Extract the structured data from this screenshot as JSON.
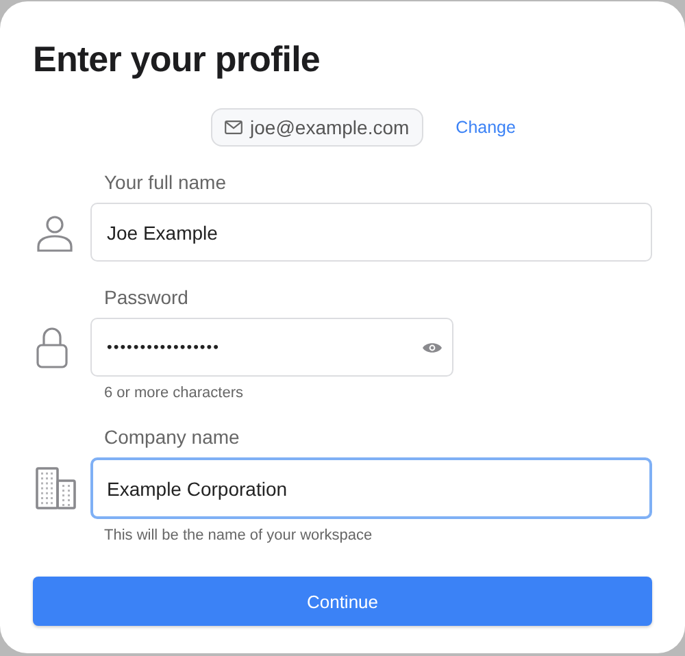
{
  "dialog": {
    "title": "Enter your profile"
  },
  "account": {
    "email": "joe@example.com",
    "change_link": "Change"
  },
  "fields": [
    {
      "kind": "person",
      "label": "Your full name",
      "value": "Joe Example",
      "masked": false,
      "focused": false
    },
    {
      "kind": "lock",
      "label": "Password",
      "value": "•••••••••••••••••",
      "masked": true,
      "focused": false,
      "hint": "6 or more characters"
    },
    {
      "kind": "building",
      "label": "Company name",
      "value": "Example Corporation",
      "masked": false,
      "focused": true,
      "hint": "This will be the name of your workspace"
    }
  ],
  "submit": "Continue"
}
